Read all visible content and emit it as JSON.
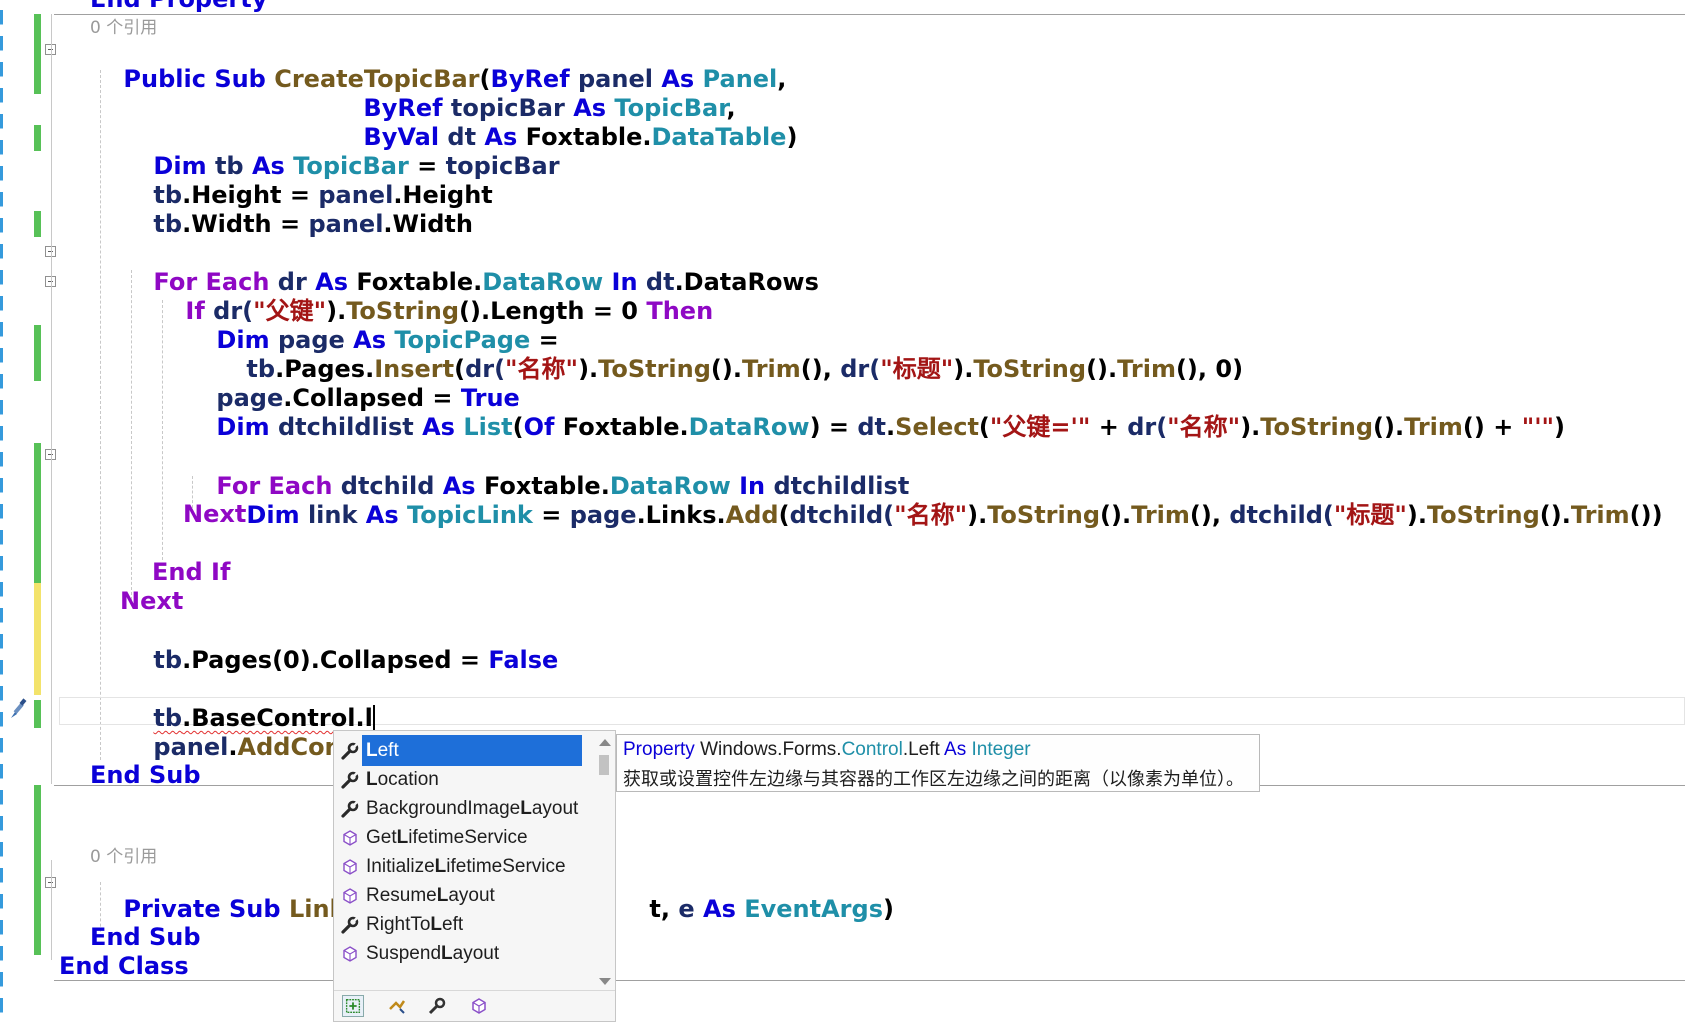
{
  "editor": {
    "refs": {
      "top": "0 个引用",
      "bottom": "0 个引用"
    },
    "code": {
      "l0": "End Property",
      "l1": [
        "Public Sub ",
        "CreateTopicBar",
        "(",
        "ByRef ",
        "panel ",
        "As ",
        "Panel",
        ","
      ],
      "l2": [
        "ByRef ",
        "topicBar ",
        "As ",
        "TopicBar",
        ","
      ],
      "l3": [
        "ByVal ",
        "dt ",
        "As ",
        "Foxtable.",
        "DataTable",
        ")"
      ],
      "l4": [
        "Dim ",
        "tb ",
        "As ",
        "TopicBar",
        " = ",
        "topicBar"
      ],
      "l5": [
        "tb",
        ".Height = ",
        "panel",
        ".Height"
      ],
      "l6": [
        "tb",
        ".Width = ",
        "panel",
        ".Width"
      ],
      "l7": [
        "For Each ",
        "dr ",
        "As ",
        "Foxtable.",
        "DataRow",
        " In ",
        "dt",
        ".DataRows"
      ],
      "l8": [
        "If ",
        "dr(",
        "\"父键\"",
        ").",
        "ToString",
        "().Length = 0 ",
        "Then"
      ],
      "l9": [
        "Dim ",
        "page ",
        "As ",
        "TopicPage",
        " ="
      ],
      "l10": [
        "tb",
        ".Pages.",
        "Insert",
        "(",
        "dr(",
        "\"名称\"",
        ").",
        "ToString",
        "().",
        "Trim",
        "(), ",
        "dr(",
        "\"标题\"",
        ").",
        "ToString",
        "().",
        "Trim",
        "(), 0)"
      ],
      "l11": [
        "page",
        ".Collapsed = ",
        "True"
      ],
      "l12": [
        "Dim ",
        "dtchildlist ",
        "As ",
        "List",
        "(",
        "Of ",
        "Foxtable.",
        "DataRow",
        ") = ",
        "dt",
        ".",
        "Select",
        "(",
        "\"父键='\"",
        " + ",
        "dr(",
        "\"名称\"",
        ").",
        "ToString",
        "().",
        "Trim",
        "() + ",
        "\"'\"",
        ")"
      ],
      "l13": [
        "For Each ",
        "dtchild ",
        "As ",
        "Foxtable.",
        "DataRow",
        " In ",
        "dtchildlist"
      ],
      "l14": [
        "Dim ",
        "link ",
        "As ",
        "TopicLink",
        " = ",
        "page",
        ".Links.",
        "Add",
        "(",
        "dtchild(",
        "\"名称\"",
        ").",
        "ToString",
        "().",
        "Trim",
        "(), ",
        "dtchild(",
        "\"标题\"",
        ").",
        "ToString",
        "().",
        "Trim",
        "())"
      ],
      "l15": "Next",
      "l16": "End If",
      "l17": "Next",
      "l18": [
        "tb",
        ".Pages(0).Collapsed = ",
        "False"
      ],
      "l19": [
        "tb",
        ".BaseControl.l"
      ],
      "l20": [
        "panel",
        ".",
        "AddContr"
      ],
      "l21": "End Sub",
      "l22": [
        "Private Sub ",
        "Link_C"
      ],
      "l22b": [
        "t, ",
        "e ",
        "As ",
        "EventArgs",
        ")"
      ],
      "l23": "End Sub",
      "l24": "End Class"
    }
  },
  "completion": {
    "items": [
      {
        "pre": "",
        "match": "L",
        "post": "eft",
        "kind": "property"
      },
      {
        "pre": "",
        "match": "L",
        "post": "ocation",
        "kind": "property"
      },
      {
        "pre": "BackgroundImage",
        "match": "L",
        "post": "ayout",
        "kind": "property"
      },
      {
        "pre": "Get",
        "match": "L",
        "post": "ifetimeService",
        "kind": "method"
      },
      {
        "pre": "Initialize",
        "match": "L",
        "post": "ifetimeService",
        "kind": "method"
      },
      {
        "pre": "Resume",
        "match": "L",
        "post": "ayout",
        "kind": "method"
      },
      {
        "pre": "RightTo",
        "match": "L",
        "post": "eft",
        "kind": "property"
      },
      {
        "pre": "Suspend",
        "match": "L",
        "post": "ayout",
        "kind": "method"
      }
    ],
    "selected": "Left",
    "filters": [
      "add-filter-icon",
      "event-filter-icon",
      "property-filter-icon",
      "method-filter-icon"
    ]
  },
  "tooltip": {
    "prefix": "Property ",
    "ns": "Windows.Forms.",
    "cls": "Control",
    "member": ".Left ",
    "as": "As ",
    "type": "Integer",
    "description": "获取或设置控件左边缘与其容器的工作区左边缘之间的距离（以像素为单位）。"
  },
  "colors": {
    "keyword": "#0a00d8",
    "control": "#8f08c4",
    "type": "#1f8fa8",
    "method": "#745a1e",
    "string": "#a31515",
    "selection": "#1e6fd9",
    "changed": "#57c157",
    "unsaved": "#f3e36b"
  }
}
